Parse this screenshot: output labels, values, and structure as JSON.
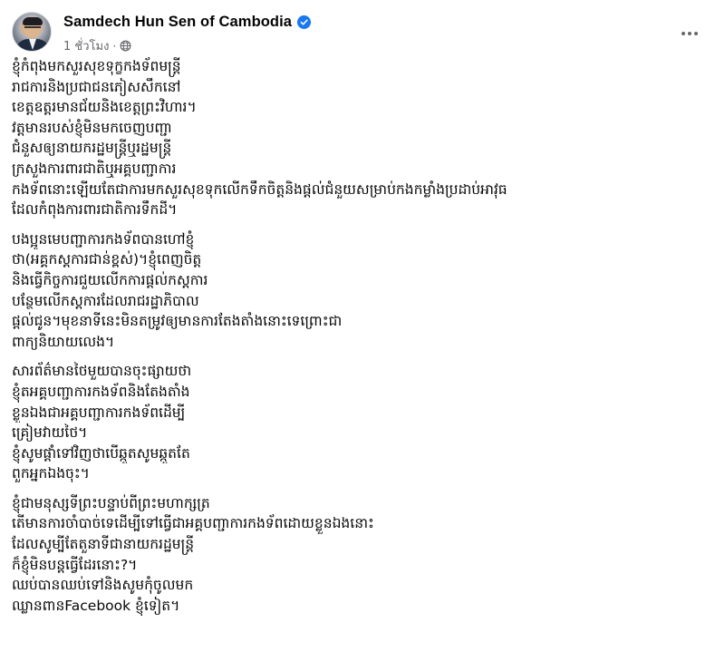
{
  "post": {
    "author_name": "Samdech Hun Sen of Cambodia",
    "timestamp": "1 ชั่วโมง",
    "separator": "·",
    "icons": {
      "verified": "verified-badge-icon",
      "audience": "globe-icon",
      "more": "more-options-icon"
    },
    "colors": {
      "verified_blue": "#1877f2",
      "secondary_text": "#65676b",
      "primary_text": "#050505"
    },
    "paragraphs": [
      {
        "lines": [
          "ខ្ញុំកំពុងមកសួរសុខទុក្ខកងទ័ពមន្ត្រី",
          "រាជការនិងប្រជាជនភៀសសឹកនៅ",
          "ខេត្តឧត្តរមានជ័យនិងខេត្តព្រះវិហារ។",
          "វត្តមានរបស់ខ្ញុំមិនមកចេញបញ្ជា",
          "ជំនួសឲ្យនាយករដ្ឋមន្ត្រីឬរដ្ឋមន្ត្រី",
          "ក្រសួងការពារជាតិឬអគ្គបញ្ជាការ",
          "កងទ័ពនោះឡើយតែជាការមកសួរសុខទុកលើកទឹកចិត្តនិងផ្តល់ជំនួយសម្រាប់កងកម្លាំងប្រដាប់អាវុធ",
          "ដែលកំពុងការពារជាតិការទឹកដី។"
        ]
      },
      {
        "lines": [
          "បងប្អូនមេបញ្ជាការកងទ័ពបានហៅខ្ញុំ",
          "ថា(អគ្គកស្តការជាន់ខ្ពស់)។ខ្ញុំពេញចិត្ត",
          "និងធ្វើកិច្ចការជួយលើកការផ្តល់កស្តការ",
          "បន្ថែមលើកស្តការដែលរាជរដ្ឋាភិបាល",
          "ផ្តល់ជូន។មុខនាទីនេះមិនតម្រូវឲ្យមានការតែងតាំងនោះទេព្រោះជា",
          "ពាក្យនិយាយលេង។"
        ]
      },
      {
        "lines": [
          "សារព័ត៌មានថៃមួយបានចុះផ្សាយថា",
          "ខ្ញុំតអគ្គបញ្ជាការកងទ័ពនិងតែងតាំង",
          "ខ្លួនឯងជាអគ្គបញ្ជាការកងទ័ពដើម្បី",
          "គ្រៀមវាយថៃ។",
          "ខ្ញុំសូមផ្តាំទៅវិញថាបើឆ្កួតសូមឆ្កួតតែ",
          "ពួកអ្នកឯងចុះ។"
        ]
      },
      {
        "lines": [
          "ខ្ញុំជាមនុស្សទីព្រះបន្ទាប់ពីព្រះមហាក្សត្រ",
          "តើមានការចាំបាច់ទេដើម្បីទៅធ្វើជាអគ្គបញ្ជាការកងទ័ពដោយខ្លួនឯងនោះ",
          "ដែលសូម្បីតែតួនាទីជានាយករដ្ឋមន្ត្រី",
          "ក៏ខ្ញុំមិនបន្តធ្វើដែរនោះ?។",
          "ឈប់បានឈប់ទៅនិងសូមកុំចូលមក",
          "ឈ្លានពានFacebook ខ្ញុំទៀត។"
        ]
      }
    ]
  }
}
